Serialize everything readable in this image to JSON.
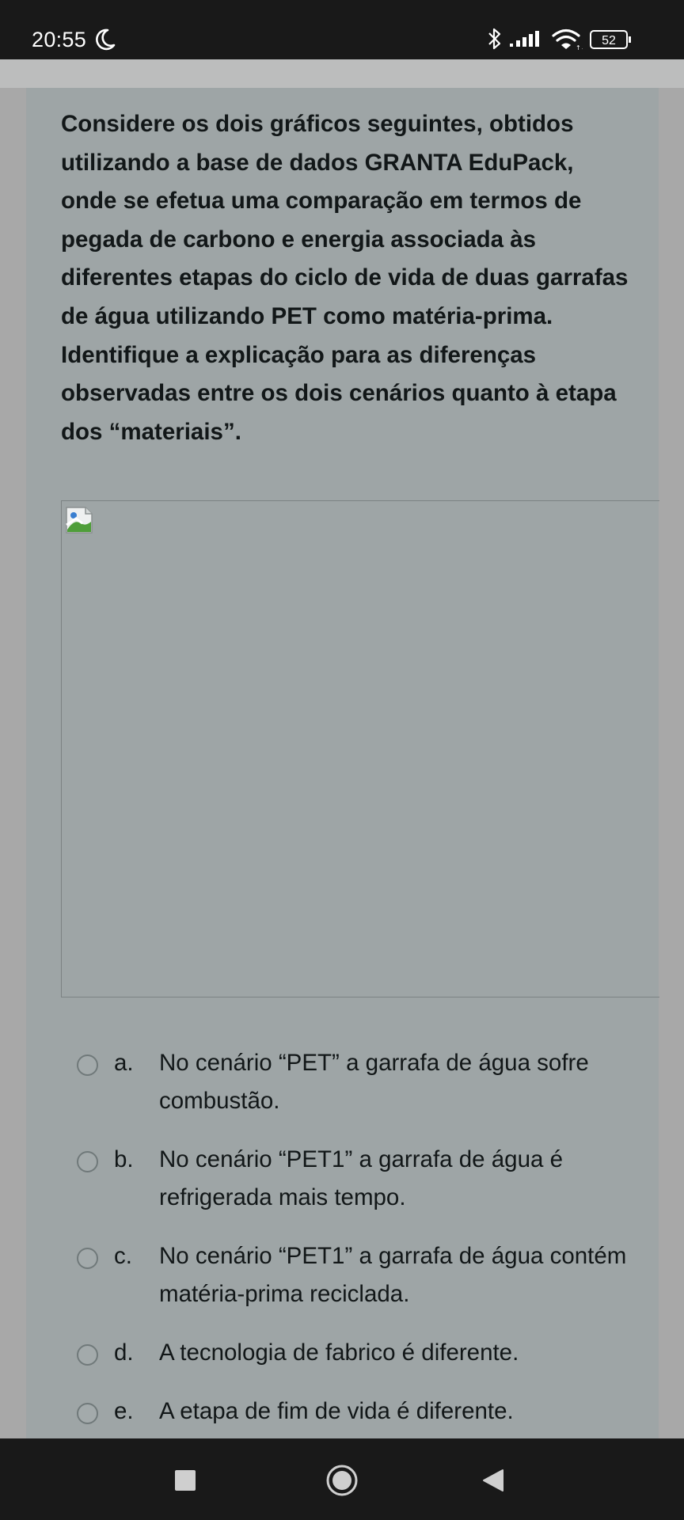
{
  "status_bar": {
    "time": "20:55",
    "battery": "52",
    "icons": [
      "moon-icon",
      "bluetooth-icon",
      "signal-icon",
      "wifi-icon",
      "battery-icon"
    ]
  },
  "question": {
    "text": "Considere os dois gráficos seguintes, obtidos utilizando a base de dados GRANTA EduPack, onde se efetua uma comparação em termos de pegada de carbono e energia associada às diferentes etapas do ciclo de vida de duas garrafas de água utilizando PET como matéria-prima. Identifique a explicação para as diferenças observadas entre os dois cenários quanto à etapa dos “materiais”."
  },
  "image": {
    "icon": "broken-image-icon"
  },
  "options": [
    {
      "letter": "a.",
      "text": "No cenário “PET” a garrafa de água sofre combustão."
    },
    {
      "letter": "b.",
      "text": "No cenário “PET1” a garrafa de água é refrigerada mais tempo."
    },
    {
      "letter": "c.",
      "text": "No cenário “PET1” a garrafa de água contém matéria-prima reciclada."
    },
    {
      "letter": "d.",
      "text": "A tecnologia de fabrico é diferente."
    },
    {
      "letter": "e.",
      "text": "A etapa de fim de vida é diferente."
    }
  ],
  "nav_bar": {
    "icons": [
      "recents-square-icon",
      "home-circle-icon",
      "back-triangle-icon"
    ]
  },
  "colors": {
    "status_bar": "#191919",
    "card_background": "#9ea5a6",
    "page_background": "#a8a8a8",
    "text": "#121718"
  }
}
